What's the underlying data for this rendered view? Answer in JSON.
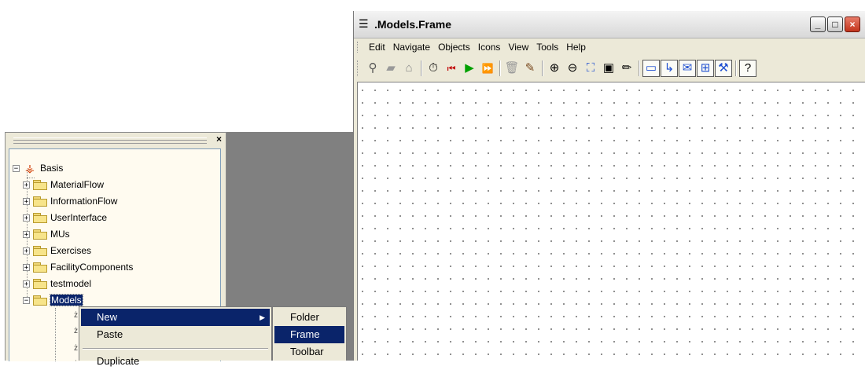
{
  "tree_panel": {
    "close_glyph": "×",
    "root": {
      "label": "Basis",
      "expander": "−",
      "icon": "basis-icon"
    },
    "items": [
      {
        "label": "MaterialFlow",
        "expander": "+"
      },
      {
        "label": "InformationFlow",
        "expander": "+"
      },
      {
        "label": "UserInterface",
        "expander": "+"
      },
      {
        "label": "MUs",
        "expander": "+"
      },
      {
        "label": "Exercises",
        "expander": "+"
      },
      {
        "label": "FacilityComponents",
        "expander": "+"
      },
      {
        "label": "testmodel",
        "expander": "+"
      },
      {
        "label": "Models",
        "expander": "−",
        "selected": true
      }
    ]
  },
  "frame_window": {
    "title": ".Models.Frame",
    "buttons": {
      "minimize": "_",
      "maximize": "□",
      "close": "×"
    },
    "menu": [
      "Edit",
      "Navigate",
      "Objects",
      "Icons",
      "View",
      "Tools",
      "Help"
    ],
    "toolbar_icons": [
      "binoculars-icon",
      "folder-icon",
      "home-icon",
      "|",
      "stopwatch-icon",
      "rewind-icon",
      "play-icon",
      "fast-forward-icon",
      "|",
      "trash-icon",
      "broom-icon",
      "|",
      "zoom-in-icon",
      "zoom-out-icon",
      "fit-icon",
      "frame-icon",
      "pencil-icon",
      "|",
      "eraser-icon",
      "connector-icon",
      "comment-icon",
      "grid-icon",
      "wizard-icon",
      "|",
      "help-icon"
    ]
  },
  "context_menu": {
    "items": [
      "New",
      "Paste",
      "Duplicate"
    ],
    "submenu_arrow": "▶"
  },
  "submenu": {
    "items": [
      "Folder",
      "Frame",
      "Toolbar"
    ],
    "highlighted": "Frame"
  },
  "colors": {
    "selection": "#0a246a",
    "panel": "#ece9d8",
    "tree_background": "#fffbf0",
    "backdrop": "#808080"
  }
}
